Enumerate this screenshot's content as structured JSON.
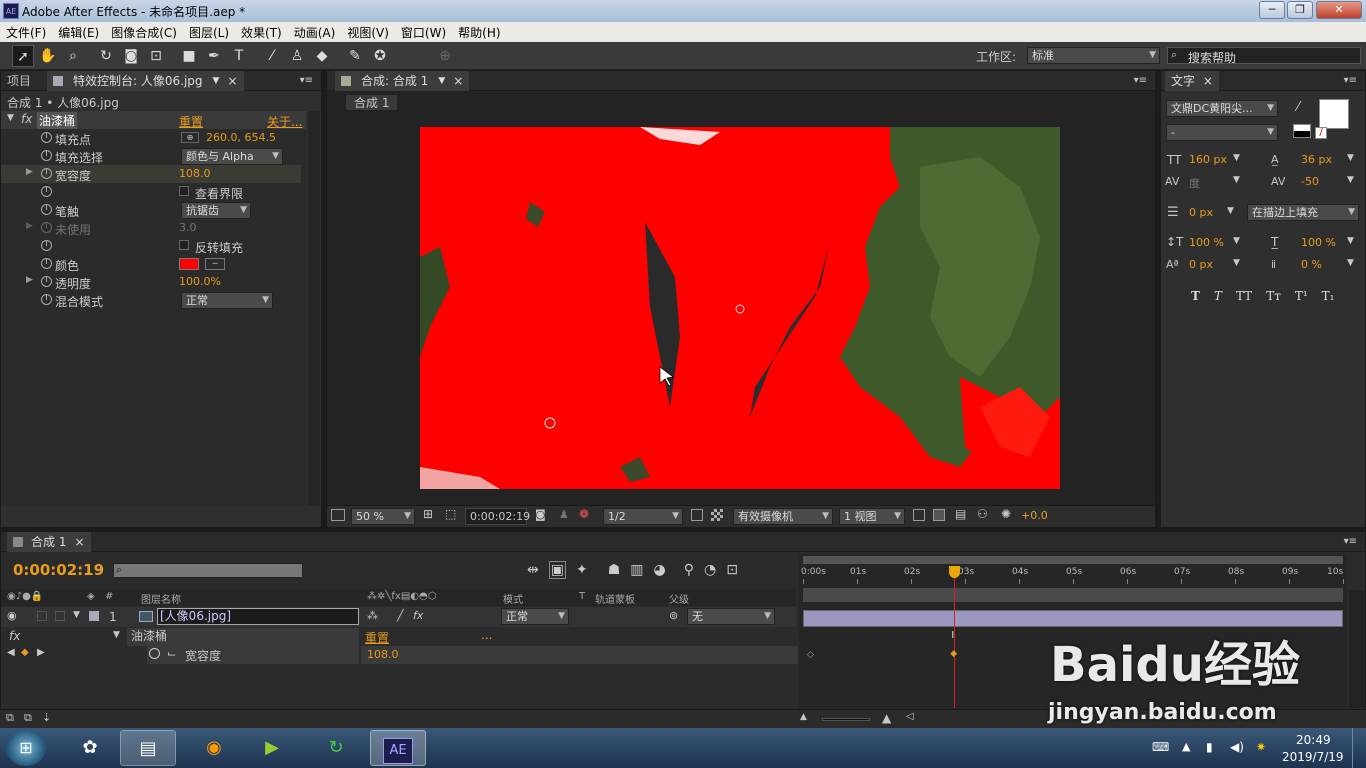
{
  "window": {
    "title": "Adobe After Effects - 未命名项目.aep *",
    "app_icon": "AE",
    "min": "─",
    "max": "❐",
    "close": "✕"
  },
  "menu": [
    "文件(F)",
    "编辑(E)",
    "图像合成(C)",
    "图层(L)",
    "效果(T)",
    "动画(A)",
    "视图(V)",
    "窗口(W)",
    "帮助(H)"
  ],
  "toolbar": {
    "workspace_label": "工作区:",
    "workspace_value": "标准",
    "search_placeholder": "搜索帮助",
    "tools": [
      "selection-tool",
      "hand-tool",
      "zoom-tool",
      "rotate-tool",
      "camera-tool",
      "pan-behind-tool",
      "rectangle-tool",
      "pen-tool",
      "type-tool",
      "brush-tool",
      "clone-stamp-tool",
      "eraser-tool",
      "roto-brush-tool",
      "puppet-pin-tool"
    ]
  },
  "left_panel": {
    "tab_project": "项目",
    "tab_effects": "特效控制台: 人像06.jpg",
    "breadcrumb": "合成 1 • 人像06.jpg",
    "effect": {
      "fx": "fx",
      "name": "油漆桶",
      "reset": "重置",
      "about": "关于..."
    },
    "props": [
      {
        "label": "填充点",
        "value": "260.0, 654.5"
      },
      {
        "label": "填充选择",
        "value": "颜色与 Alpha"
      },
      {
        "label": "宽容度",
        "value": "108.0"
      },
      {
        "label": "",
        "value": "查看界限"
      },
      {
        "label": "笔触",
        "value": "抗锯齿"
      },
      {
        "label": "未使用",
        "value": "3.0"
      },
      {
        "label": "",
        "value": "反转填充"
      },
      {
        "label": "颜色",
        "value": ""
      },
      {
        "label": "透明度",
        "value": "100.0%"
      },
      {
        "label": "混合模式",
        "value": "正常"
      }
    ]
  },
  "comp_panel": {
    "tab": "合成: 合成 1",
    "subtab": "合成 1",
    "zoom": "50 %",
    "timecode": "0:00:02:19",
    "resolution": "1/2",
    "camera": "有效摄像机",
    "views": "1 视图",
    "exposure": "+0.0"
  },
  "text_panel": {
    "tab": "文字",
    "font": "文鼎DC黄阳尖...",
    "style": "-",
    "size": "160 px",
    "leading": "36 px",
    "tracking_label": "度",
    "kerning": "-50",
    "stroke": "0 px",
    "stroke_mode": "在描边上填充",
    "vscale": "100 %",
    "hscale": "100 %",
    "baseline": "0 px",
    "tsume": "0 %",
    "styles": [
      "T",
      "T",
      "TT",
      "Tт",
      "T¹",
      "T₁"
    ]
  },
  "timeline": {
    "tab": "合成 1",
    "timecode": "0:00:02:19",
    "col_headers": {
      "name": "图层名称",
      "mode": "模式",
      "t": "T",
      "trkmat": "轨道蒙板",
      "parent": "父级",
      "num": "#"
    },
    "layer": {
      "num": "1",
      "name": "[人像06.jpg]",
      "mode": "正常",
      "parent": "无"
    },
    "effect_row": {
      "fx": "fx",
      "name": "油漆桶",
      "reset": "重置",
      "dots": "..."
    },
    "prop_row": {
      "name": "宽容度",
      "value": "108.0"
    },
    "ruler": [
      "0:00s",
      "01s",
      "02s",
      "03s",
      "04s",
      "05s",
      "06s",
      "07s",
      "08s",
      "09s",
      "10s"
    ],
    "playhead_fraction": 0.28
  },
  "watermark": {
    "brand": "Baidu经验",
    "url": "jingyan.baidu.com"
  },
  "taskbar": {
    "time": "20:49",
    "date": "2019/7/19",
    "apps": [
      "start-orb",
      "media-player-icon",
      "file-explorer-icon",
      "firefox-icon",
      "camtasia-icon",
      "refresh-app-icon",
      "after-effects-icon"
    ],
    "ae_label": "AE"
  }
}
